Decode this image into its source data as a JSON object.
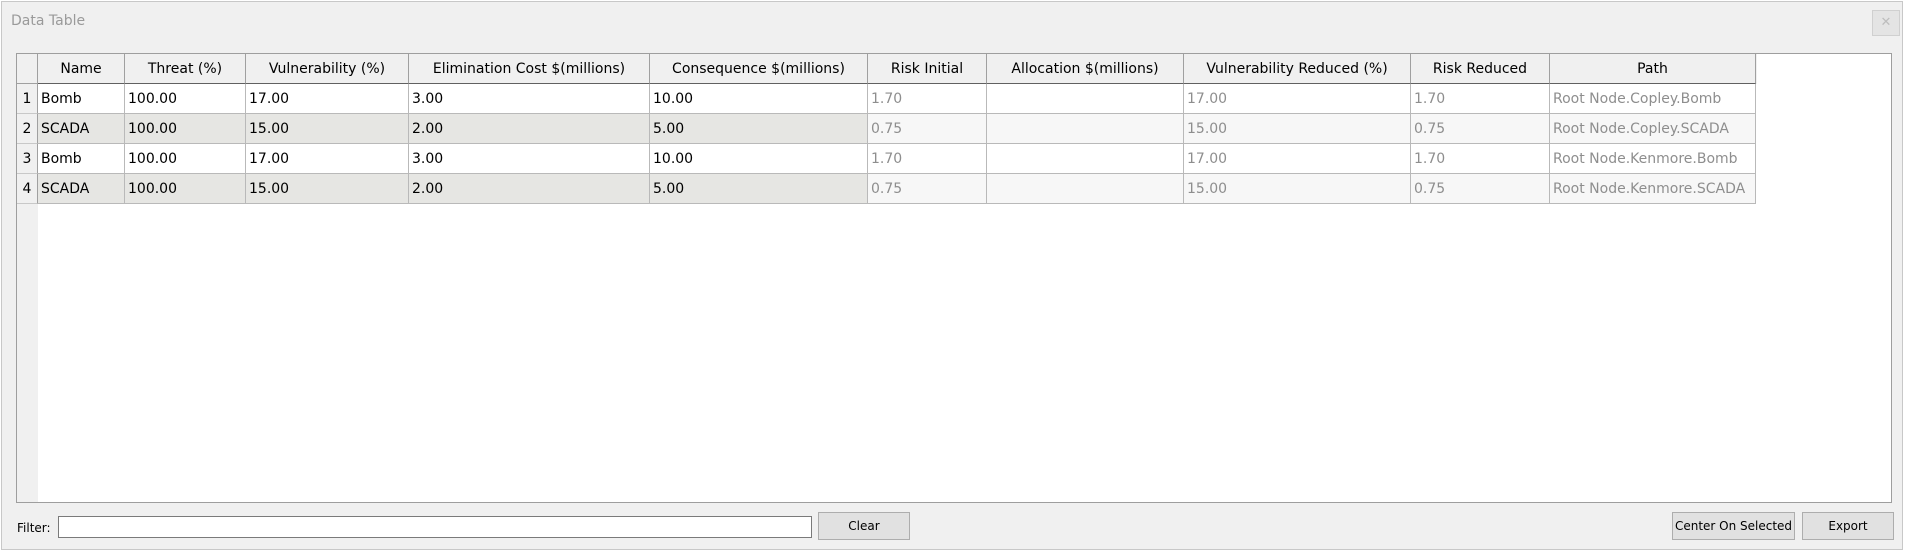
{
  "window": {
    "title": "Data Table",
    "close_glyph": "✕"
  },
  "table": {
    "columns": [
      "Name",
      "Threat (%)",
      "Vulnerability (%)",
      "Elimination Cost $(millions)",
      "Consequence $(millions)",
      "Risk Initial",
      "Allocation $(millions)",
      "Vulnerability Reduced (%)",
      "Risk Reduced",
      "Path"
    ],
    "rows": [
      {
        "num": "1",
        "cells": [
          "Bomb",
          "100.00",
          "17.00",
          "3.00",
          "10.00",
          "1.70",
          "",
          "17.00",
          "1.70",
          "Root Node.Copley.Bomb"
        ]
      },
      {
        "num": "2",
        "cells": [
          "SCADA",
          "100.00",
          "15.00",
          "2.00",
          "5.00",
          "0.75",
          "",
          "15.00",
          "0.75",
          "Root Node.Copley.SCADA"
        ]
      },
      {
        "num": "3",
        "cells": [
          "Bomb",
          "100.00",
          "17.00",
          "3.00",
          "10.00",
          "1.70",
          "",
          "17.00",
          "1.70",
          "Root Node.Kenmore.Bomb"
        ]
      },
      {
        "num": "4",
        "cells": [
          "SCADA",
          "100.00",
          "15.00",
          "2.00",
          "5.00",
          "0.75",
          "",
          "15.00",
          "0.75",
          "Root Node.Kenmore.SCADA"
        ]
      }
    ]
  },
  "filter": {
    "label": "Filter:",
    "value": "",
    "placeholder": ""
  },
  "buttons": {
    "clear": "Clear",
    "center_on_selected": "Center On Selected",
    "export": "Export"
  }
}
